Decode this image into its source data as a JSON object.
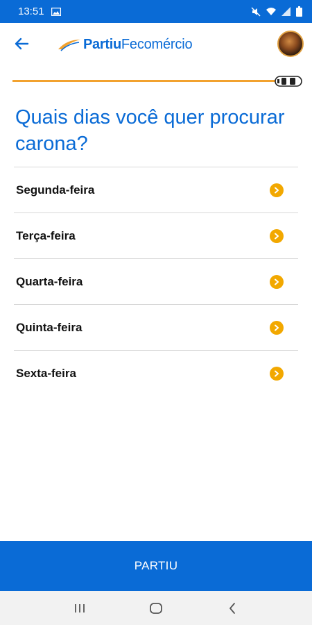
{
  "status_bar": {
    "time": "13:51",
    "icons": [
      "image-icon",
      "mute-icon",
      "wifi-icon",
      "signal-icon",
      "battery-icon"
    ]
  },
  "header": {
    "back_icon": "arrow-left-icon",
    "logo_bold": "Partiu",
    "logo_light": "Fecomércio",
    "avatar": "user-avatar"
  },
  "progress": {
    "icon": "car-icon",
    "color": "#f2a22f"
  },
  "title": "Quais dias você quer procurar carona?",
  "days": [
    {
      "label": "Segunda-feira"
    },
    {
      "label": "Terça-feira"
    },
    {
      "label": "Quarta-feira"
    },
    {
      "label": "Quinta-feira"
    },
    {
      "label": "Sexta-feira"
    }
  ],
  "primary_button": {
    "label": "PARTIU"
  },
  "nav_bar": {
    "icons": [
      "recent-apps-icon",
      "home-icon",
      "back-icon"
    ]
  },
  "colors": {
    "brand_blue": "#0a6bd6",
    "accent_orange": "#f2a800"
  }
}
